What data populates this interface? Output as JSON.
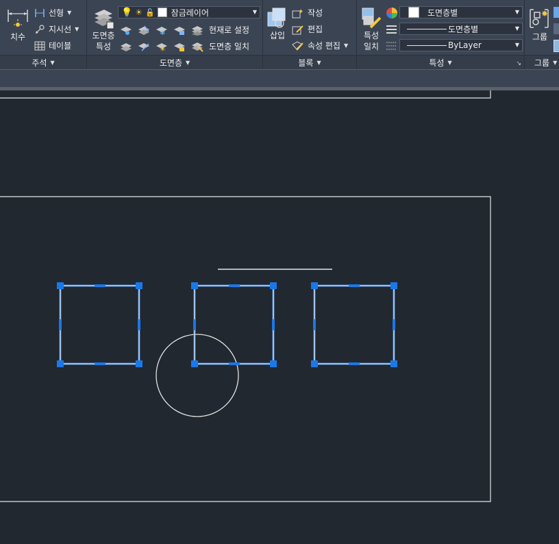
{
  "ribbon": {
    "annotation": {
      "title": "주석",
      "dimension": "치수",
      "linear": "선형",
      "leader": "지시선",
      "table": "테이블"
    },
    "layers": {
      "title": "도면층",
      "properties_line1": "도면층",
      "properties_line2": "특성",
      "layer_combo": "잠금레이어",
      "set_current": "현재로 설정",
      "match_layer": "도면층 일치"
    },
    "block": {
      "title": "블록",
      "insert": "삽입",
      "create": "작성",
      "edit": "편집",
      "edit_attributes": "속성 편집"
    },
    "properties": {
      "title": "특성",
      "match_line1": "특성",
      "match_line2": "일치",
      "color_combo": "도면층별",
      "linetype_combo": "도면층별",
      "lineweight_combo": "ByLayer"
    },
    "groups": {
      "title": "그룹",
      "group": "그룹"
    }
  },
  "colors": {
    "ribbon_bg": "#3b4453",
    "canvas_bg": "#212830",
    "selection": "#4a8fe8",
    "grip": "#1a78e8",
    "geometry": "#e6e6e6"
  }
}
